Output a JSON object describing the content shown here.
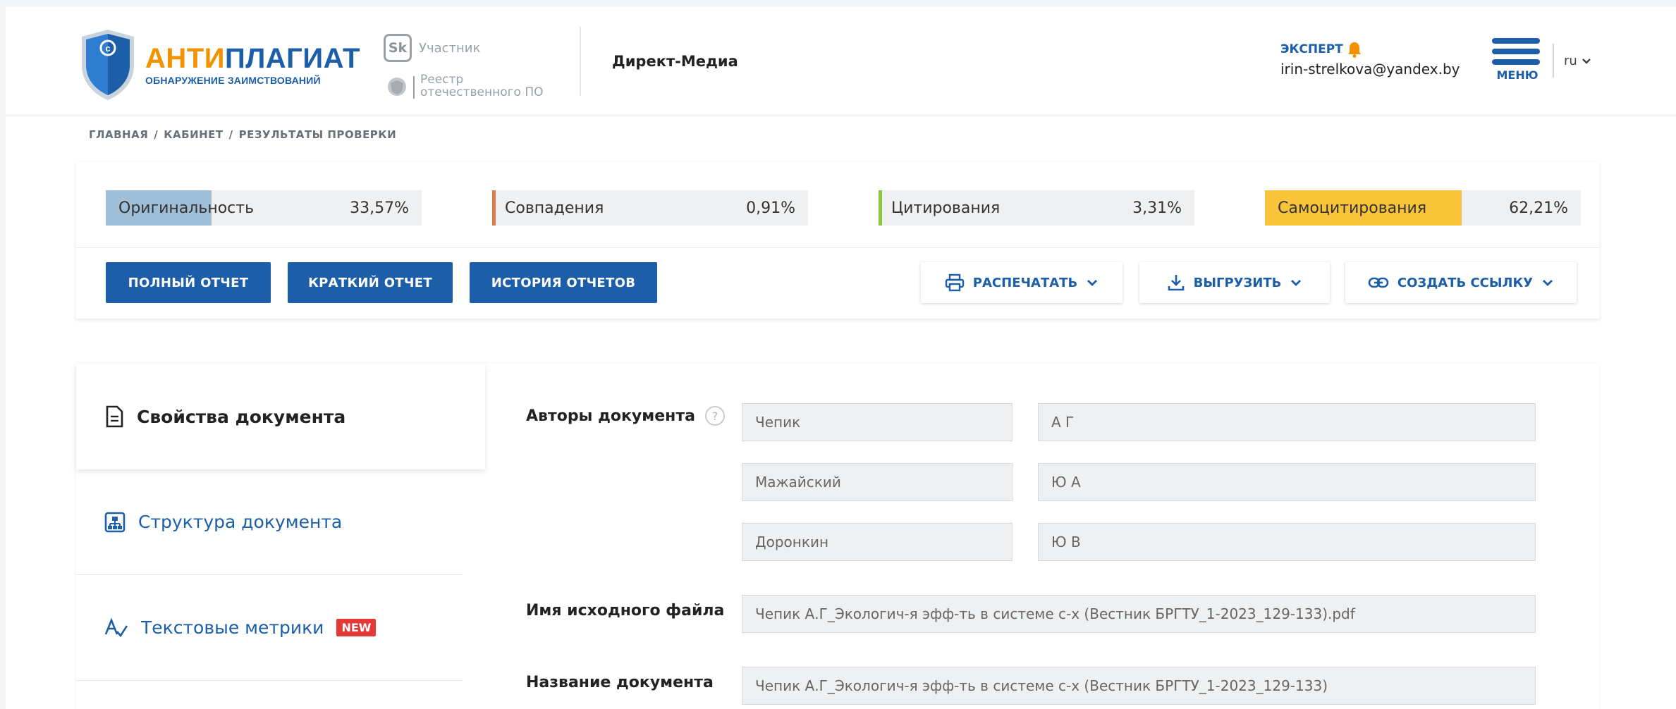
{
  "header": {
    "brand_title_a": "АНТИ",
    "brand_title_b": "ПЛАГИАТ",
    "brand_subtitle": "ОБНАРУЖЕНИЕ ЗАИМСТВОВАНИЙ",
    "sk_badge": "Sk",
    "sk_label": "Участник",
    "reestr_label_1": "Реестр",
    "reestr_label_2": "отечественного ПО",
    "organization": "Директ-Медиа",
    "user_role": "ЭКСПЕРТ",
    "user_email": "irin-strelkova@yandex.by",
    "menu_label": "МЕНЮ",
    "language": "ru"
  },
  "breadcrumb": [
    "ГЛАВНАЯ",
    "КАБИНЕТ",
    "РЕЗУЛЬТАТЫ ПРОВЕРКИ"
  ],
  "stats": [
    {
      "label": "Оригинальность",
      "value": "33,57%",
      "fraction": 0.3357,
      "color": "#9fbfd9"
    },
    {
      "label": "Совпадения",
      "value": "0,91%",
      "fraction": 0.0091,
      "color": "#e07a45"
    },
    {
      "label": "Цитирования",
      "value": "3,31%",
      "fraction": 0.0331,
      "color": "#8cc63f"
    },
    {
      "label": "Самоцитирования",
      "value": "62,21%",
      "fraction": 0.6221,
      "color": "#f9c33a"
    }
  ],
  "actions": {
    "full_report": "ПОЛНЫЙ ОТЧЕТ",
    "short_report": "КРАТКИЙ ОТЧЕТ",
    "report_history": "ИСТОРИЯ ОТЧЕТОВ",
    "print": "РАСПЕЧАТАТЬ",
    "export": "ВЫГРУЗИТЬ",
    "create_link": "СОЗДАТЬ ССЫЛКУ"
  },
  "sidebar": {
    "properties": "Свойства документа",
    "structure": "Структура документа",
    "metrics": "Текстовые метрики",
    "new_badge": "NEW"
  },
  "document": {
    "authors_label": "Авторы документа",
    "help_glyph": "?",
    "authors": [
      {
        "last": "Чепик",
        "initials": "А Г"
      },
      {
        "last": "Мажайский",
        "initials": "Ю А"
      },
      {
        "last": "Доронкин",
        "initials": "Ю В"
      }
    ],
    "filename_label": "Имя исходного файла",
    "filename": "Чепик А.Г_Экологич-я эфф-ть в системе с-х (Вестник БРГТУ_1-2023_129-133).pdf",
    "title_label": "Название документа",
    "title": "Чепик А.Г_Экологич-я эфф-ть в системе с-х (Вестник БРГТУ_1-2023_129-133)"
  }
}
